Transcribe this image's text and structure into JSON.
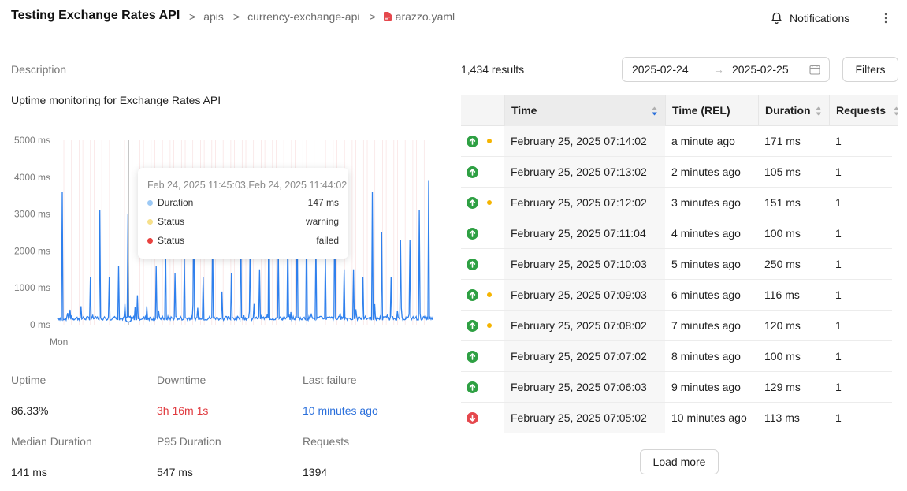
{
  "header": {
    "title": "Testing Exchange Rates API",
    "breadcrumb": [
      ">",
      "apis",
      ">",
      "currency-exchange-api",
      ">"
    ],
    "file_name": "arazzo.yaml",
    "notifications_label": "Notifications"
  },
  "description": {
    "label": "Description",
    "text": "Uptime monitoring for Exchange Rates API"
  },
  "chart_data": {
    "type": "line",
    "title": "",
    "xlabel": "",
    "ylabel": "",
    "y_ticks": [
      "5000 ms",
      "4000 ms",
      "3000 ms",
      "2000 ms",
      "1000 ms",
      "0 ms"
    ],
    "x_ticks": [
      "Mon"
    ],
    "ylim": [
      0,
      5000
    ],
    "grid": false,
    "series": [
      {
        "name": "Duration",
        "color": "#2f80ed",
        "baseline_ms": 120,
        "spikes_ms": [
          3600,
          250,
          500,
          1300,
          3100,
          1300,
          1600,
          3000,
          800,
          500,
          1600,
          2300,
          1400,
          1800,
          3400,
          1300,
          2500,
          900,
          1400,
          3100,
          2400,
          1500,
          4100,
          2000,
          2500,
          3100,
          3000,
          2200,
          1900,
          3400,
          1500,
          1500,
          1300,
          3600,
          2500,
          1300,
          2300,
          2300,
          3100,
          3900
        ]
      }
    ],
    "tooltip": {
      "title": "Feb 24, 2025 11:45:03,Feb 24, 2025 11:44:02",
      "rows": [
        {
          "label": "Duration",
          "value": "147 ms",
          "color": "#9cc9f5"
        },
        {
          "label": "Status",
          "value": "warning",
          "color": "#f7e08a"
        },
        {
          "label": "Status",
          "value": "failed",
          "color": "#e8423f"
        }
      ]
    }
  },
  "stats": [
    {
      "label": "Uptime",
      "value": "86.33%",
      "style": "normal"
    },
    {
      "label": "Downtime",
      "value": "3h 16m 1s",
      "style": "red"
    },
    {
      "label": "Last failure",
      "value": "10 minutes ago",
      "style": "link"
    },
    {
      "label": "Median Duration",
      "value": "141 ms",
      "style": "normal"
    },
    {
      "label": "P95 Duration",
      "value": "547 ms",
      "style": "normal"
    },
    {
      "label": "Requests",
      "value": "1394",
      "style": "normal"
    }
  ],
  "results": {
    "count": "1,434 results",
    "date_from": "2025-02-24",
    "date_arrow": "→",
    "date_to": "2025-02-25",
    "filters_label": "Filters",
    "load_more_label": "Load more"
  },
  "table": {
    "columns": [
      "Time",
      "Time (REL)",
      "Duration",
      "Requests"
    ],
    "rows": [
      {
        "status": "up",
        "warning": true,
        "time": "February 25, 2025 07:14:02",
        "rel": "a minute ago",
        "duration": "171 ms",
        "requests": "1"
      },
      {
        "status": "up",
        "warning": false,
        "time": "February 25, 2025 07:13:02",
        "rel": "2 minutes ago",
        "duration": "105 ms",
        "requests": "1"
      },
      {
        "status": "up",
        "warning": true,
        "time": "February 25, 2025 07:12:02",
        "rel": "3 minutes ago",
        "duration": "151 ms",
        "requests": "1"
      },
      {
        "status": "up",
        "warning": false,
        "time": "February 25, 2025 07:11:04",
        "rel": "4 minutes ago",
        "duration": "100 ms",
        "requests": "1"
      },
      {
        "status": "up",
        "warning": false,
        "time": "February 25, 2025 07:10:03",
        "rel": "5 minutes ago",
        "duration": "250 ms",
        "requests": "1"
      },
      {
        "status": "up",
        "warning": true,
        "time": "February 25, 2025 07:09:03",
        "rel": "6 minutes ago",
        "duration": "116 ms",
        "requests": "1"
      },
      {
        "status": "up",
        "warning": true,
        "time": "February 25, 2025 07:08:02",
        "rel": "7 minutes ago",
        "duration": "120 ms",
        "requests": "1"
      },
      {
        "status": "up",
        "warning": false,
        "time": "February 25, 2025 07:07:02",
        "rel": "8 minutes ago",
        "duration": "100 ms",
        "requests": "1"
      },
      {
        "status": "up",
        "warning": false,
        "time": "February 25, 2025 07:06:03",
        "rel": "9 minutes ago",
        "duration": "129 ms",
        "requests": "1"
      },
      {
        "status": "down",
        "warning": false,
        "time": "February 25, 2025 07:05:02",
        "rel": "10 minutes ago",
        "duration": "113 ms",
        "requests": "1"
      }
    ]
  },
  "colors": {
    "up": "#2ea043",
    "down": "#e5484d",
    "warning": "#f5b400",
    "accent": "#2a6fdb",
    "series": "#2f80ed"
  }
}
